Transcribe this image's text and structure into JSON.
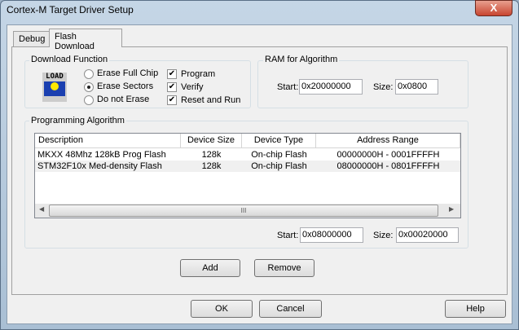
{
  "window": {
    "title": "Cortex-M Target Driver Setup",
    "close_label": "X"
  },
  "tabs": [
    {
      "label": "Debug"
    },
    {
      "label": "Flash Download"
    }
  ],
  "download_function": {
    "title": "Download Function",
    "icon_text": "LOAD",
    "erase_options": [
      {
        "label": "Erase Full Chip",
        "selected": false
      },
      {
        "label": "Erase Sectors",
        "selected": true
      },
      {
        "label": "Do not Erase",
        "selected": false
      }
    ],
    "checks": [
      {
        "label": "Program",
        "checked": true
      },
      {
        "label": "Verify",
        "checked": true
      },
      {
        "label": "Reset and Run",
        "checked": true
      }
    ]
  },
  "ram": {
    "title": "RAM for Algorithm",
    "start_label": "Start:",
    "start": "0x20000000",
    "size_label": "Size:",
    "size": "0x0800"
  },
  "algorithm": {
    "title": "Programming Algorithm",
    "columns": [
      "Description",
      "Device Size",
      "Device Type",
      "Address Range"
    ],
    "rows": [
      [
        "MKXX 48Mhz 128kB Prog Flash",
        "128k",
        "On-chip Flash",
        "00000000H - 0001FFFFH"
      ],
      [
        "STM32F10x Med-density Flash",
        "128k",
        "On-chip Flash",
        "08000000H - 0801FFFFH"
      ]
    ],
    "scroll_grip": "III",
    "start_label": "Start:",
    "start": "0x08000000",
    "size_label": "Size:",
    "size": "0x00020000",
    "add_label": "Add",
    "remove_label": "Remove"
  },
  "footer": {
    "ok": "OK",
    "cancel": "Cancel",
    "help": "Help"
  }
}
